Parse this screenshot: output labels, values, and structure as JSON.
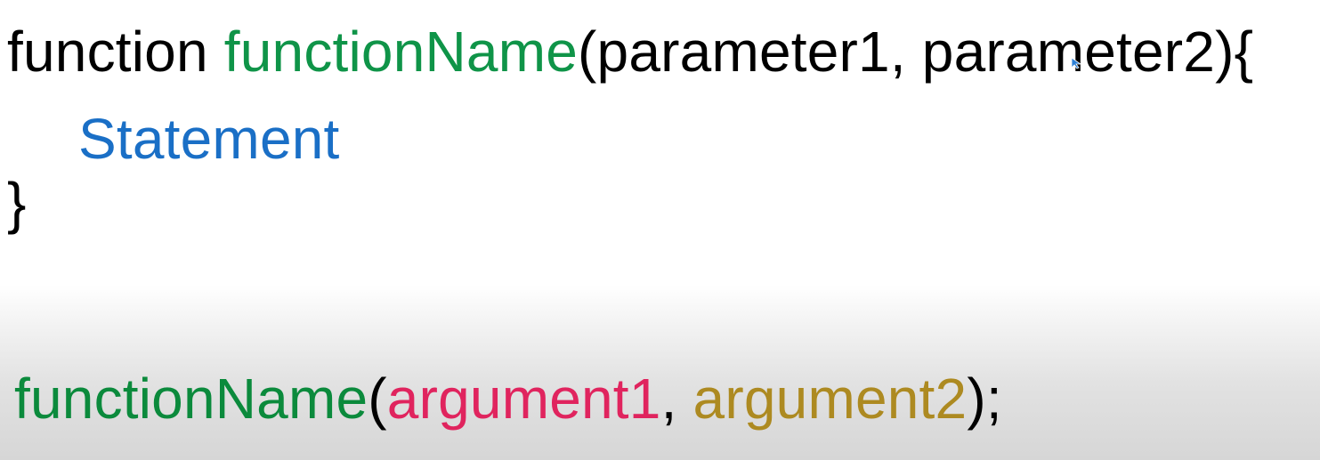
{
  "definition": {
    "keyword": "function",
    "space": " ",
    "function_name": "functionName",
    "open_paren": "(",
    "param1": "parameter1",
    "comma": ", ",
    "param2": "parameter2",
    "close_paren_brace": "){",
    "statement": "Statement",
    "close_brace": "}"
  },
  "call": {
    "function_name": "functionName",
    "open_paren": "(",
    "arg1": "argument1",
    "comma": ", ",
    "arg2": "argument2",
    "close": ");"
  },
  "colors": {
    "function_name": "#0f9448",
    "statement": "#1a6fc6",
    "argument1": "#e0245e",
    "argument2": "#ad8a21",
    "text": "#000000"
  },
  "icons": {
    "cursor": "mouse-pointer-icon"
  }
}
